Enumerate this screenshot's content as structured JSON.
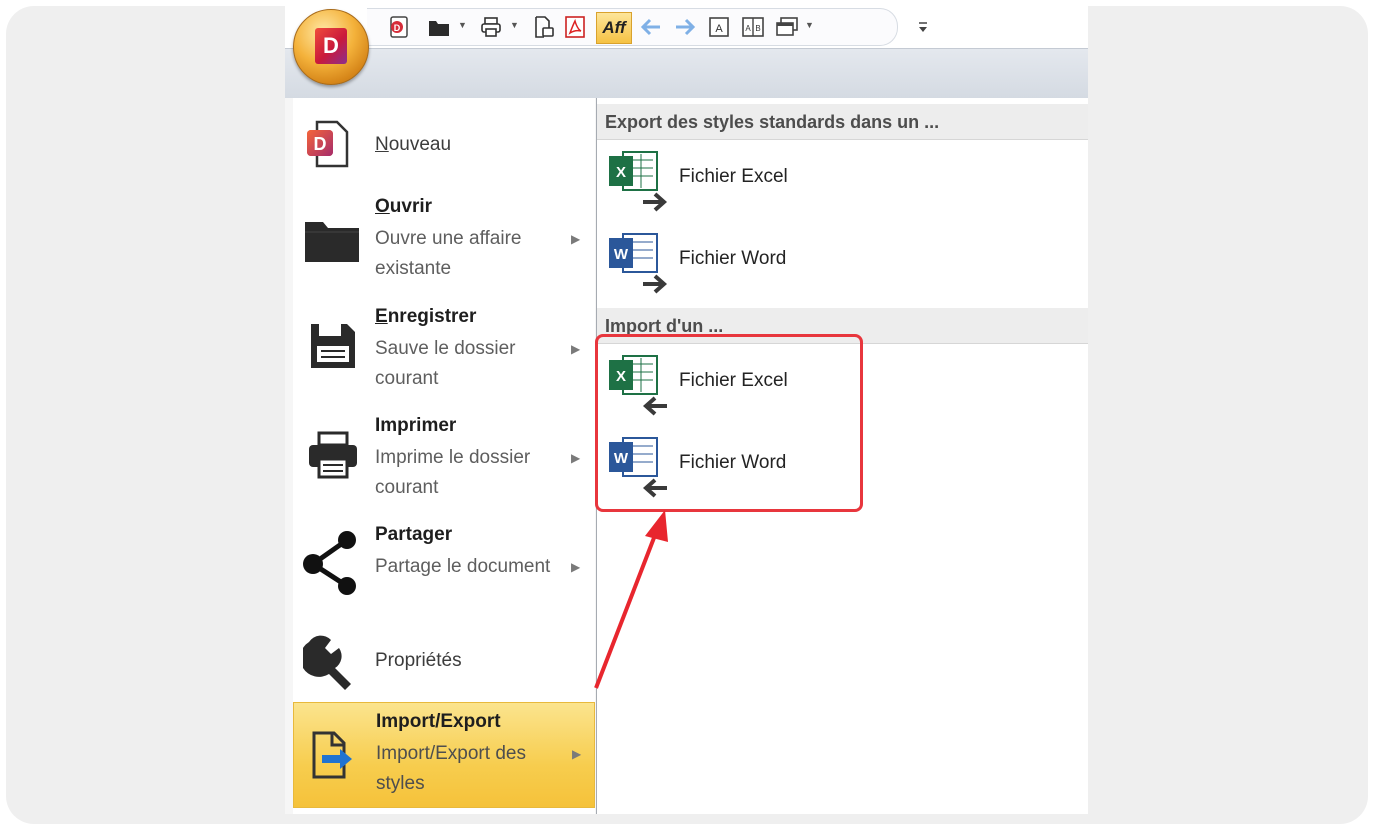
{
  "app": {
    "logo_letter": "D",
    "brand_color": "#d02a3a"
  },
  "toolbar": {
    "icons": [
      "new-doc-icon",
      "folder-icon",
      "print-icon",
      "print-preview-icon",
      "pdf-icon",
      "aff-icon",
      "undo-icon",
      "redo-icon",
      "frame-a-icon",
      "frame-ab-icon",
      "window-icon",
      "customize-icon"
    ],
    "aff_label": "Aff"
  },
  "menu": {
    "items": [
      {
        "id": "nouveau",
        "title_first": "N",
        "title_rest": "ouveau",
        "subtitle": "",
        "has_arrow": false
      },
      {
        "id": "ouvrir",
        "title_first": "O",
        "title_rest": "uvrir",
        "subtitle": "Ouvre une affaire existante",
        "has_arrow": true
      },
      {
        "id": "enregistrer",
        "title_first": "E",
        "title_rest": "nregistrer",
        "subtitle": "Sauve le dossier courant",
        "has_arrow": true
      },
      {
        "id": "imprimer",
        "title_first": "",
        "title_rest": "Imprimer",
        "subtitle": "Imprime le dossier courant",
        "has_arrow": true
      },
      {
        "id": "partager",
        "title_first": "",
        "title_rest": "Partager",
        "subtitle": "Partage le document",
        "has_arrow": true
      },
      {
        "id": "proprietes",
        "title_first": "",
        "title_rest": "Propriétés",
        "subtitle": "",
        "has_arrow": false
      },
      {
        "id": "import-export",
        "title_first": "",
        "title_rest": "Import/Export",
        "subtitle": "Import/Export des styles",
        "has_arrow": true,
        "active": true
      }
    ],
    "arrow_glyph": "▶"
  },
  "panel": {
    "export_header": "Export des styles standards dans un ...",
    "import_header": "Import d'un ...",
    "export_items": [
      {
        "label": "Fichier Excel",
        "icon": "excel-export-icon"
      },
      {
        "label": "Fichier Word",
        "icon": "word-export-icon"
      }
    ],
    "import_items": [
      {
        "label": "Fichier Excel",
        "icon": "excel-import-icon"
      },
      {
        "label": "Fichier Word",
        "icon": "word-import-icon"
      }
    ]
  },
  "colors": {
    "highlight": "#e8363d",
    "active_menu": "#f7cd4e",
    "excel_green": "#1e7145",
    "word_blue": "#2b579a"
  }
}
